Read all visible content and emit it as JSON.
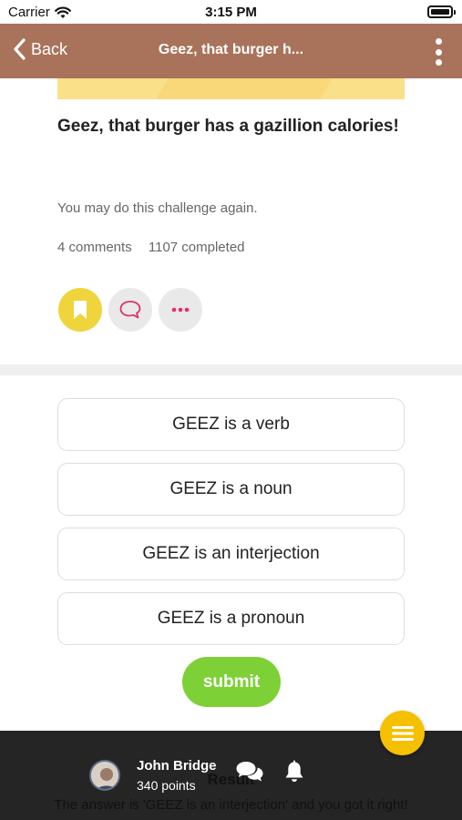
{
  "status_bar": {
    "carrier": "Carrier",
    "time": "3:15 PM"
  },
  "nav": {
    "back_label": "Back",
    "title": "Geez, that burger h..."
  },
  "challenge": {
    "title": "Geez, that burger has a gazillion calories!",
    "again_text": "You may do this challenge again.",
    "comments": "4 comments",
    "completed": "1107 completed"
  },
  "options": [
    "GEEZ is a verb",
    "GEEZ is a noun",
    "GEEZ is an interjection",
    "GEEZ is a pronoun"
  ],
  "submit_label": "submit",
  "result": {
    "title": "Result",
    "text": "The answer is 'GEEZ is an interjection' and you got it right!"
  },
  "user": {
    "name": "John Bridge",
    "points": "340 points"
  },
  "colors": {
    "nav": "#a8735a",
    "bookmark": "#f0d43c",
    "submit": "#7ed037",
    "fab": "#f5c000",
    "accent_pink": "#e0306a"
  },
  "icons": [
    "wifi-icon",
    "battery-icon",
    "chevron-left-icon",
    "more-vertical-icon",
    "bookmark-icon",
    "comment-icon",
    "more-horizontal-icon",
    "chat-icon",
    "bell-icon",
    "menu-icon"
  ]
}
